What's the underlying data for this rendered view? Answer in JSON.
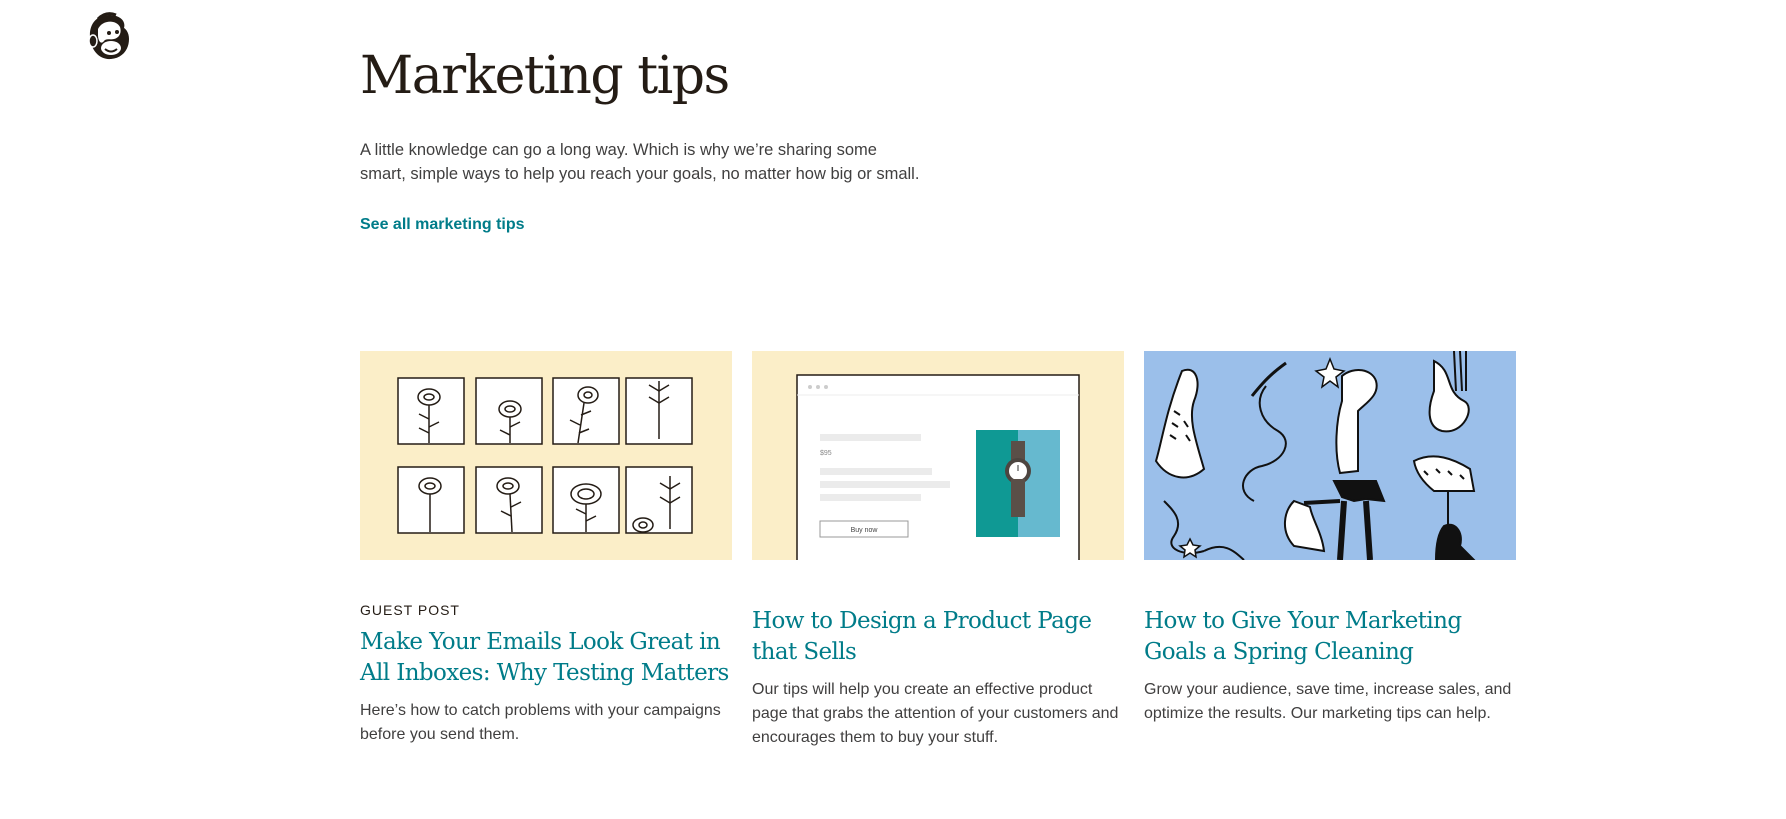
{
  "brand": {
    "logo_icon": "mailchimp-freddie-logo"
  },
  "hero": {
    "title": "Marketing tips",
    "intro_line1": "A little knowledge can go a long way. Which is why we’re sharing some",
    "intro_line2": "smart, simple ways to help you reach your goals, no matter how big or small.",
    "see_all": "See all marketing tips"
  },
  "cards": [
    {
      "eyebrow": "GUEST POST",
      "title": "Make Your Emails Look Great in All Inboxes: Why Testing Matters",
      "description": "Here’s how to catch problems with your campaigns before you send them.",
      "image_icon": "flower-grid-illustration",
      "bg_color": "#fbeec8"
    },
    {
      "eyebrow": "",
      "title": "How to Design a Product Page that Sells",
      "description": "Our tips will help you create an effective product page that grabs the attention of your customers and encourages them to buy your stuff.",
      "image_icon": "product-page-illustration",
      "bg_color": "#fbeec8",
      "mock_price": "$95",
      "mock_button": "Buy now"
    },
    {
      "eyebrow": "",
      "title": "How to Give Your Marketing Goals a Spring Cleaning",
      "description": "Grow your audience, save time, increase sales, and optimize the results. Our marketing tips can help.",
      "image_icon": "spring-cleaning-illustration",
      "bg_color": "#9bbfea"
    }
  ],
  "colors": {
    "link": "#007c89",
    "text": "#241c15",
    "body": "#403f3f"
  }
}
